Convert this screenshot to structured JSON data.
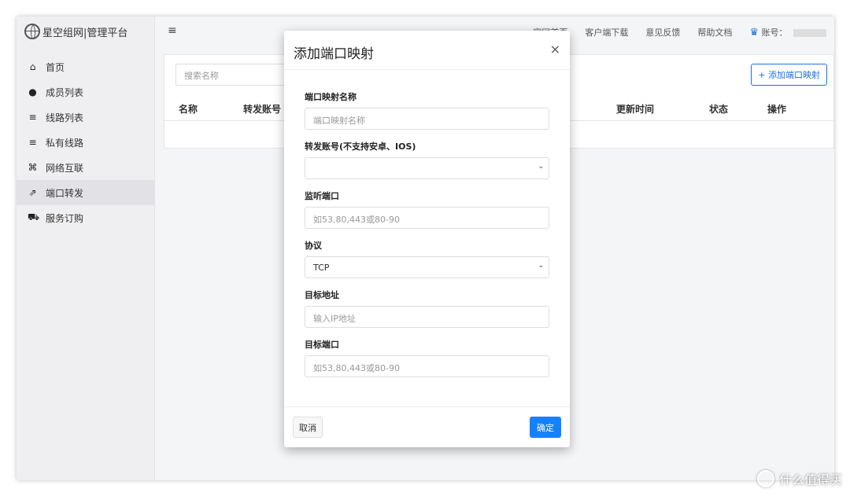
{
  "brand": {
    "title": "星空组网|管理平台"
  },
  "sidebar": {
    "items": [
      {
        "label": "首页",
        "icon": "home-icon",
        "glyph": "⌂"
      },
      {
        "label": "成员列表",
        "icon": "user-icon",
        "glyph": "●"
      },
      {
        "label": "线路列表",
        "icon": "list-icon",
        "glyph": "≡"
      },
      {
        "label": "私有线路",
        "icon": "list-icon",
        "glyph": "≡"
      },
      {
        "label": "网络互联",
        "icon": "network-icon",
        "glyph": "⌘"
      },
      {
        "label": "端口转发",
        "icon": "share-icon",
        "glyph": "⇗"
      },
      {
        "label": "服务订购",
        "icon": "cart-icon",
        "glyph": "⛟"
      }
    ],
    "active_index": 5
  },
  "topbar": {
    "links": [
      "官网首页",
      "客户端下载",
      "意见反馈",
      "帮助文档"
    ],
    "account_label": "账号："
  },
  "main": {
    "search_placeholder": "搜索名称",
    "add_button": "+ 添加端口映射",
    "columns": [
      "名称",
      "转发账号",
      "更新时间",
      "状态",
      "操作"
    ]
  },
  "modal": {
    "title": "添加端口映射",
    "close": "×",
    "fields": [
      {
        "label": "端口映射名称",
        "placeholder": "端口映射名称",
        "type": "input"
      },
      {
        "label": "转发账号(不支持安卓、IOS)",
        "value": "",
        "type": "select"
      },
      {
        "label": "监听端口",
        "placeholder": "如53,80,443或80-90",
        "type": "input"
      },
      {
        "label": "协议",
        "value": "TCP",
        "type": "select"
      },
      {
        "label": "目标地址",
        "placeholder": "输入IP地址",
        "type": "input"
      },
      {
        "label": "目标端口",
        "placeholder": "如53,80,443或80-90",
        "type": "input"
      }
    ],
    "cancel": "取消",
    "confirm": "确定"
  },
  "watermark": {
    "text": "什么值得买"
  },
  "colors": {
    "primary": "#1780ff",
    "accent_border": "#1f6fe0"
  }
}
